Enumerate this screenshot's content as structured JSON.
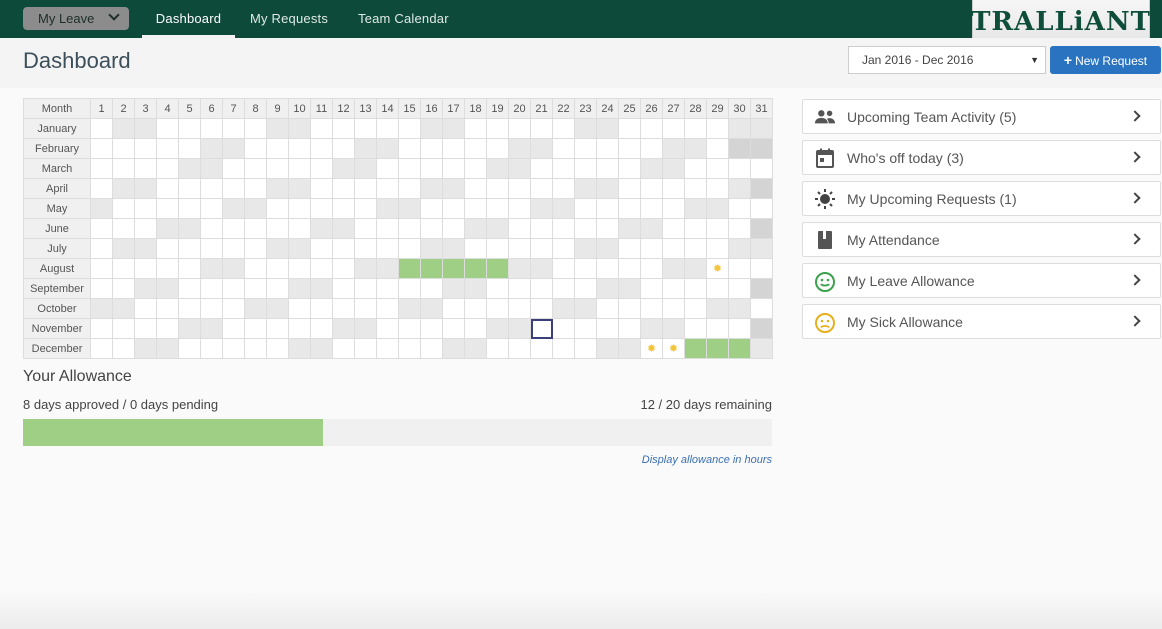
{
  "nav": {
    "menu_label": "My Leave",
    "tabs": [
      "Dashboard",
      "My Requests",
      "Team Calendar"
    ],
    "logo_text": "TRALLiANT"
  },
  "header": {
    "title": "Dashboard",
    "date_range": "Jan 2016 - Dec 2016",
    "new_request_label": "New Request"
  },
  "calendar": {
    "month_header": "Month",
    "days": [
      "1",
      "2",
      "3",
      "4",
      "5",
      "6",
      "7",
      "8",
      "9",
      "10",
      "11",
      "12",
      "13",
      "14",
      "15",
      "16",
      "17",
      "18",
      "19",
      "20",
      "21",
      "22",
      "23",
      "24",
      "25",
      "26",
      "27",
      "28",
      "29",
      "30",
      "31"
    ],
    "months": [
      "January",
      "February",
      "March",
      "April",
      "May",
      "June",
      "July",
      "August",
      "September",
      "October",
      "November",
      "December"
    ],
    "leave_days": {
      "August": [
        15,
        16,
        17,
        18,
        19
      ],
      "December": [
        28,
        29,
        30
      ]
    },
    "request_days": {
      "August": [
        29
      ],
      "December": [
        26,
        27
      ]
    },
    "today": {
      "month": "November",
      "day": 21
    }
  },
  "allowance": {
    "title": "Your Allowance",
    "approved_text": "8 days approved / 0 days pending",
    "remaining_text": "12 / 20 days remaining",
    "used_fraction": 0.4,
    "hours_link": "Display allowance in hours"
  },
  "panels": [
    {
      "label": "Upcoming Team Activity (5)",
      "icon": "team-icon"
    },
    {
      "label": "Who's off today (3)",
      "icon": "calendar-icon"
    },
    {
      "label": "My Upcoming Requests (1)",
      "icon": "sun-icon"
    },
    {
      "label": "My Attendance",
      "icon": "book-icon"
    },
    {
      "label": "My Leave Allowance",
      "icon": "smile-icon"
    },
    {
      "label": "My Sick Allowance",
      "icon": "frown-icon"
    }
  ],
  "colors": {
    "nav_bg": "#0e4a3a",
    "leave": "#9fcf85",
    "button": "#2a73c1",
    "happy_icon": "#3aa24a",
    "sick_icon": "#e6b01c"
  }
}
